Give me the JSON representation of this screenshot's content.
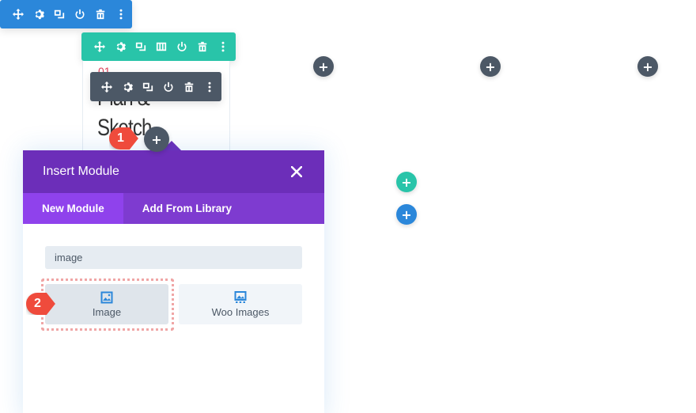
{
  "section_toolbar": {
    "color": "#2b87da",
    "icons": [
      "move-icon",
      "settings-icon",
      "duplicate-icon",
      "disable-icon",
      "delete-icon",
      "more-icon"
    ]
  },
  "row_toolbar": {
    "color": "#29c4a9",
    "icons": [
      "move-icon",
      "settings-icon",
      "duplicate-icon",
      "columns-icon",
      "disable-icon",
      "delete-icon",
      "more-icon"
    ]
  },
  "module_toolbar": {
    "color": "#4c5866",
    "icons": [
      "move-icon",
      "settings-icon",
      "duplicate-icon",
      "disable-icon",
      "delete-icon",
      "more-icon"
    ]
  },
  "card": {
    "number": "01",
    "title_line1": "Plan &",
    "title_line2": "Sketch"
  },
  "add_buttons": {
    "symbol": "+"
  },
  "callouts": {
    "step1": "1",
    "step2": "2"
  },
  "modal": {
    "title": "Insert Module",
    "close_symbol": "×",
    "tabs": [
      {
        "label": "New Module",
        "active": true
      },
      {
        "label": "Add From Library",
        "active": false
      }
    ],
    "search_value": "image",
    "modules": [
      {
        "label": "Image",
        "icon": "image-icon",
        "highlighted": true
      },
      {
        "label": "Woo Images",
        "icon": "woo-images-icon",
        "highlighted": false
      }
    ]
  },
  "colors": {
    "purple_header": "#6c2eb9",
    "purple_tabs": "#7e3bd0",
    "purple_active_tab": "#8f42ec",
    "callout_red": "#ef4b3c",
    "green": "#29c4a9",
    "blue": "#2b87da",
    "dark": "#4c5866"
  }
}
